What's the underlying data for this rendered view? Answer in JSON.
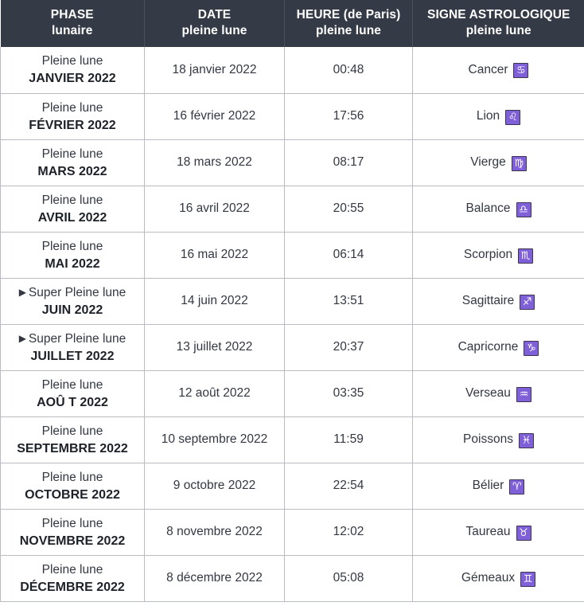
{
  "table": {
    "columns": [
      {
        "line1": "PHASE",
        "line2": "lunaire"
      },
      {
        "line1": "DATE",
        "line2": "pleine lune"
      },
      {
        "line1": "HEURE (de Paris)",
        "line2": "pleine lune"
      },
      {
        "line1": "SIGNE ASTROLOGIQUE",
        "line2": "pleine lune"
      }
    ],
    "colors": {
      "header_bg": "#343a46",
      "header_text": "#ffffff",
      "cell_border": "#b9bcc2",
      "cell_text": "#323741",
      "badge_bg": "#8060d8",
      "badge_border": "#3d3550",
      "badge_glyph": "#ffffff"
    },
    "super_marker": "▶",
    "rows": [
      {
        "phase_label": "Pleine lune",
        "phase_month": "JANVIER 2022",
        "is_super": false,
        "date": "18 janvier 2022",
        "hour": "00:48",
        "sign_name": "Cancer",
        "sign_glyph": "♋",
        "sign_icon": "cancer-icon"
      },
      {
        "phase_label": "Pleine lune",
        "phase_month": "FÉVRIER 2022",
        "is_super": false,
        "date": "16 février 2022",
        "hour": "17:56",
        "sign_name": "Lion",
        "sign_glyph": "♌",
        "sign_icon": "leo-icon"
      },
      {
        "phase_label": "Pleine lune",
        "phase_month": "MARS 2022",
        "is_super": false,
        "date": "18 mars 2022",
        "hour": "08:17",
        "sign_name": "Vierge",
        "sign_glyph": "♍",
        "sign_icon": "virgo-icon"
      },
      {
        "phase_label": "Pleine lune",
        "phase_month": "AVRIL 2022",
        "is_super": false,
        "date": "16 avril 2022",
        "hour": "20:55",
        "sign_name": "Balance",
        "sign_glyph": "♎",
        "sign_icon": "libra-icon"
      },
      {
        "phase_label": "Pleine lune",
        "phase_month": "MAI 2022",
        "is_super": false,
        "date": "16 mai 2022",
        "hour": "06:14",
        "sign_name": "Scorpion",
        "sign_glyph": "♏",
        "sign_icon": "scorpio-icon"
      },
      {
        "phase_label": "Super Pleine lune",
        "phase_month": "JUIN 2022",
        "is_super": true,
        "date": "14 juin 2022",
        "hour": "13:51",
        "sign_name": "Sagittaire",
        "sign_glyph": "♐",
        "sign_icon": "sagittarius-icon"
      },
      {
        "phase_label": "Super Pleine lune",
        "phase_month": "JUILLET 2022",
        "is_super": true,
        "date": "13 juillet 2022",
        "hour": "20:37",
        "sign_name": "Capricorne",
        "sign_glyph": "♑",
        "sign_icon": "capricorn-icon"
      },
      {
        "phase_label": "Pleine lune",
        "phase_month": "AOÛ T 2022",
        "is_super": false,
        "date": "12 août 2022",
        "hour": "03:35",
        "sign_name": "Verseau",
        "sign_glyph": "♒",
        "sign_icon": "aquarius-icon"
      },
      {
        "phase_label": "Pleine lune",
        "phase_month": "SEPTEMBRE 2022",
        "is_super": false,
        "date": "10 septembre 2022",
        "hour": "11:59",
        "sign_name": "Poissons",
        "sign_glyph": "♓",
        "sign_icon": "pisces-icon"
      },
      {
        "phase_label": "Pleine lune",
        "phase_month": "OCTOBRE 2022",
        "is_super": false,
        "date": "9 octobre 2022",
        "hour": "22:54",
        "sign_name": "Bélier",
        "sign_glyph": "♈",
        "sign_icon": "aries-icon"
      },
      {
        "phase_label": "Pleine lune",
        "phase_month": "NOVEMBRE 2022",
        "is_super": false,
        "date": "8 novembre 2022",
        "hour": "12:02",
        "sign_name": "Taureau",
        "sign_glyph": "♉",
        "sign_icon": "taurus-icon"
      },
      {
        "phase_label": "Pleine lune",
        "phase_month": "DÉCEMBRE 2022",
        "is_super": false,
        "date": "8 décembre 2022",
        "hour": "05:08",
        "sign_name": "Gémeaux",
        "sign_glyph": "♊",
        "sign_icon": "gemini-icon"
      }
    ]
  }
}
